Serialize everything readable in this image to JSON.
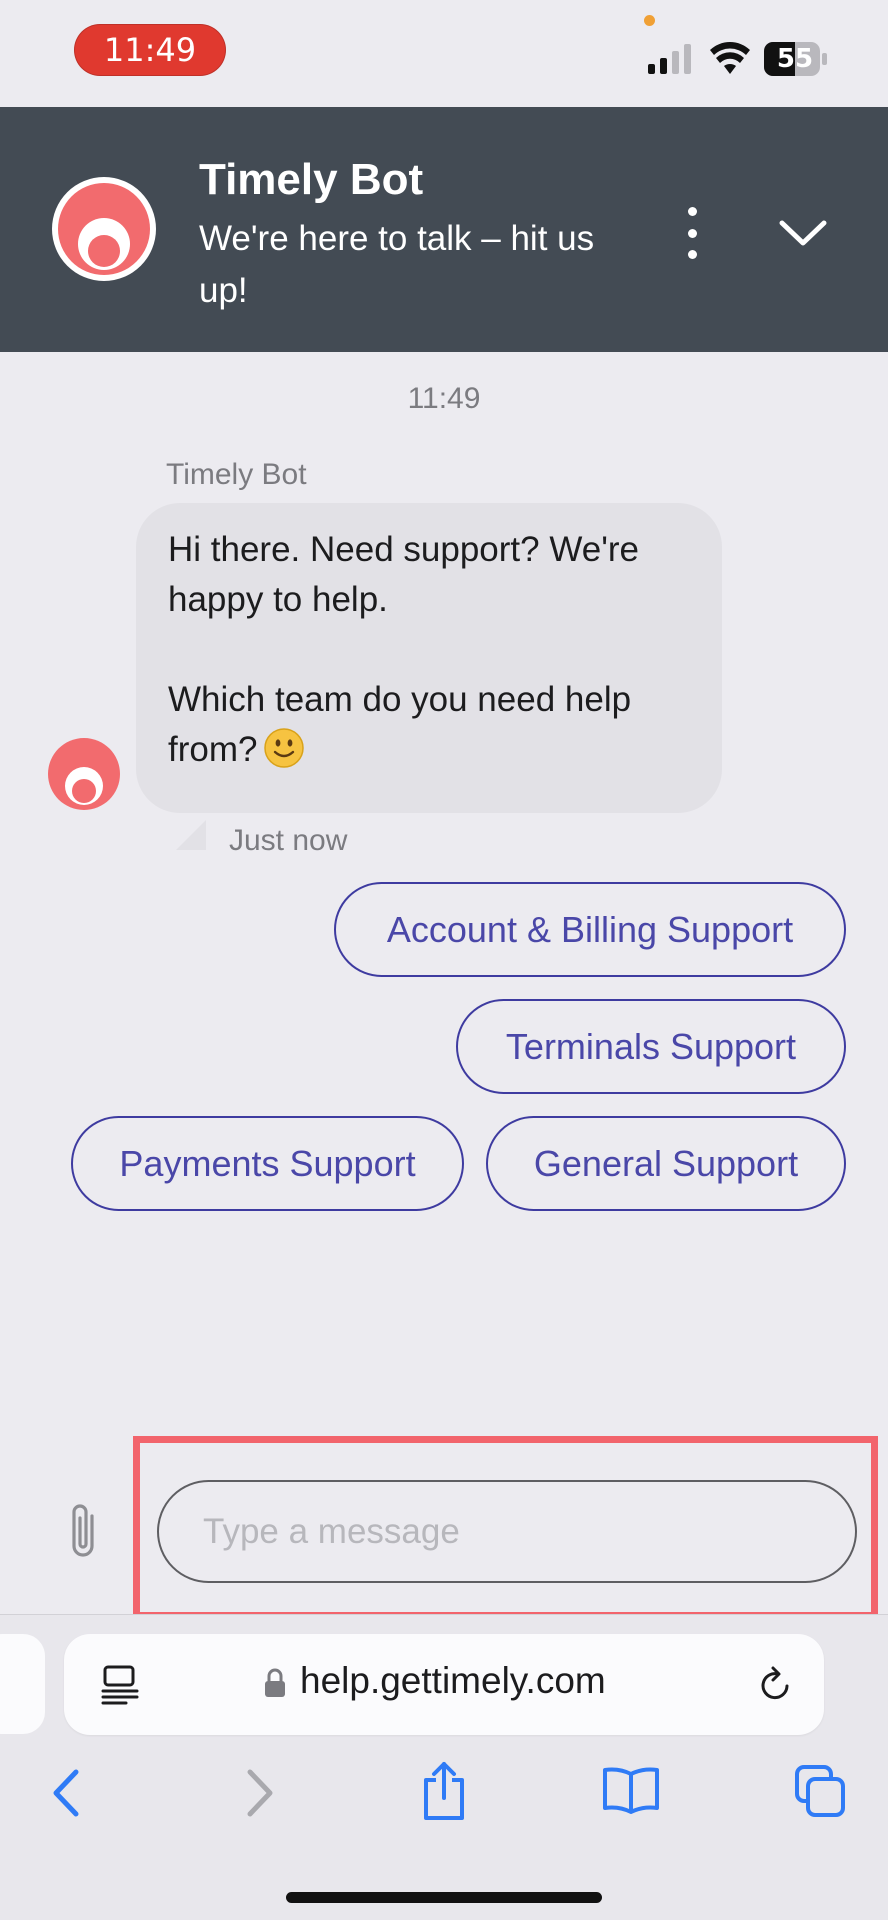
{
  "status_bar": {
    "time": "11:49",
    "battery": "55"
  },
  "header": {
    "bot_name": "Timely Bot",
    "tagline": "We're here to talk – hit us up!",
    "more_icon": "more-vertical-icon",
    "collapse_icon": "chevron-down-icon"
  },
  "conversation": {
    "timestamp": "11:49",
    "sender": "Timely Bot",
    "message_line1": "Hi there. Need support? We're",
    "message_line2": "happy to help.",
    "message_line3": "Which team do you need help",
    "message_line4": "from?",
    "message_emoji": "slightly-smiling-face",
    "sent_status": "Just now"
  },
  "quick_replies": [
    "Account & Billing Support",
    "Terminals Support",
    "Payments Support",
    "General Support"
  ],
  "composer": {
    "placeholder": "Type a message",
    "value": "",
    "attach_icon": "paperclip-icon"
  },
  "browser": {
    "url": "help.gettimely.com",
    "reader_icon": "reader-mode-icon",
    "reload_icon": "reload-icon"
  },
  "colors": {
    "header_bg": "#434b54",
    "brand_avatar": "#f26b6e",
    "quick_reply_border": "#3e3ba0",
    "composer_highlight": "#f2646c",
    "time_pill": "#e0392f",
    "browser_accent": "#2f7bf6"
  }
}
